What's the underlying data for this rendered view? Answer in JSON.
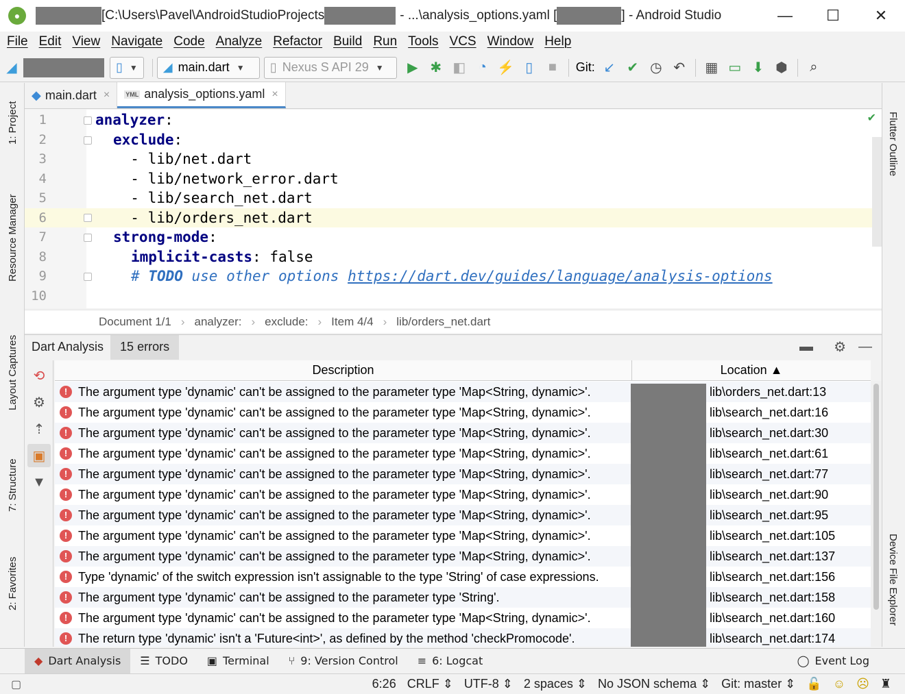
{
  "window": {
    "title_path": "[C:\\Users\\Pavel\\AndroidStudioProjects",
    "title_file": "- ...\\analysis_options.yaml [",
    "title_app": "] - Android Studio",
    "minimize": "—",
    "maximize": "☐",
    "close": "✕"
  },
  "menu": [
    "File",
    "Edit",
    "View",
    "Navigate",
    "Code",
    "Analyze",
    "Refactor",
    "Build",
    "Run",
    "Tools",
    "VCS",
    "Window",
    "Help"
  ],
  "toolbar": {
    "run_config": "main.dart",
    "device": "Nexus S API 29",
    "git_label": "Git:"
  },
  "left_tabs": [
    "1: Project",
    "Resource Manager",
    "Layout Captures",
    "7: Structure",
    "2: Favorites"
  ],
  "right_tabs": [
    "Flutter Outline",
    "Device File Explorer"
  ],
  "file_tabs": [
    {
      "name": "main.dart",
      "close": "×"
    },
    {
      "name": "analysis_options.yaml",
      "close": "×",
      "badge": "YML"
    }
  ],
  "code_lines": [
    {
      "n": "1"
    },
    {
      "n": "2"
    },
    {
      "n": "3",
      "t": "  - lib/net.dart"
    },
    {
      "n": "4",
      "t": "  - lib/network_error.dart"
    },
    {
      "n": "5",
      "t": "  - lib/search_net.dart"
    },
    {
      "n": "6",
      "t": "  - lib/orders_net.dart"
    },
    {
      "n": "7"
    },
    {
      "n": "8"
    },
    {
      "n": "9"
    },
    {
      "n": "10"
    }
  ],
  "code_tokens": {
    "analyzer": "analyzer",
    "colon": ":",
    "exclude": "exclude",
    "strong_mode": "strong-mode",
    "implicit_casts": "implicit-casts",
    "false_val": " false",
    "hash": "# ",
    "todo": "TODO",
    "todo_text": " use other options ",
    "link": "https://dart.dev/guides/language/analysis-options"
  },
  "breadcrumb": [
    "Document 1/1",
    "analyzer:",
    "exclude:",
    "Item 4/4",
    "lib/orders_net.dart"
  ],
  "breadcrumb_sep": "›",
  "analysis": {
    "title": "Dart Analysis",
    "count": "15 errors",
    "col_description": "Description",
    "col_location": "Location ▲",
    "rows": [
      {
        "d": "The argument type 'dynamic' can't be assigned to the parameter type 'Map<String, dynamic>'.",
        "l": "lib\\orders_net.dart:13"
      },
      {
        "d": "The argument type 'dynamic' can't be assigned to the parameter type 'Map<String, dynamic>'.",
        "l": "lib\\search_net.dart:16"
      },
      {
        "d": "The argument type 'dynamic' can't be assigned to the parameter type 'Map<String, dynamic>'.",
        "l": "lib\\search_net.dart:30"
      },
      {
        "d": "The argument type 'dynamic' can't be assigned to the parameter type 'Map<String, dynamic>'.",
        "l": "lib\\search_net.dart:61"
      },
      {
        "d": "The argument type 'dynamic' can't be assigned to the parameter type 'Map<String, dynamic>'.",
        "l": "lib\\search_net.dart:77"
      },
      {
        "d": "The argument type 'dynamic' can't be assigned to the parameter type 'Map<String, dynamic>'.",
        "l": "lib\\search_net.dart:90"
      },
      {
        "d": "The argument type 'dynamic' can't be assigned to the parameter type 'Map<String, dynamic>'.",
        "l": "lib\\search_net.dart:95"
      },
      {
        "d": "The argument type 'dynamic' can't be assigned to the parameter type 'Map<String, dynamic>'.",
        "l": "lib\\search_net.dart:105"
      },
      {
        "d": "The argument type 'dynamic' can't be assigned to the parameter type 'Map<String, dynamic>'.",
        "l": "lib\\search_net.dart:137"
      },
      {
        "d": "Type 'dynamic' of the switch expression isn't assignable to the type 'String' of case expressions.",
        "l": "lib\\search_net.dart:156"
      },
      {
        "d": "The argument type 'dynamic' can't be assigned to the parameter type 'String'.",
        "l": "lib\\search_net.dart:158"
      },
      {
        "d": "The argument type 'dynamic' can't be assigned to the parameter type 'Map<String, dynamic>'.",
        "l": "lib\\search_net.dart:160"
      },
      {
        "d": "The return type 'dynamic' isn't a 'Future<int>', as defined by the method 'checkPromocode'.",
        "l": "lib\\search_net.dart:174"
      }
    ]
  },
  "bottom_tabs": [
    "Dart Analysis",
    "TODO",
    "Terminal",
    "9: Version Control",
    "6: Logcat",
    "Event Log"
  ],
  "status": [
    "6:26",
    "CRLF ⇕",
    "UTF-8 ⇕",
    "2 spaces ⇕",
    "No JSON schema ⇕",
    "Git: master ⇕"
  ],
  "colors": {
    "error": "#e05555",
    "keyword": "#000080",
    "comment": "#2f6fbf",
    "current_line": "#fcfae1"
  }
}
